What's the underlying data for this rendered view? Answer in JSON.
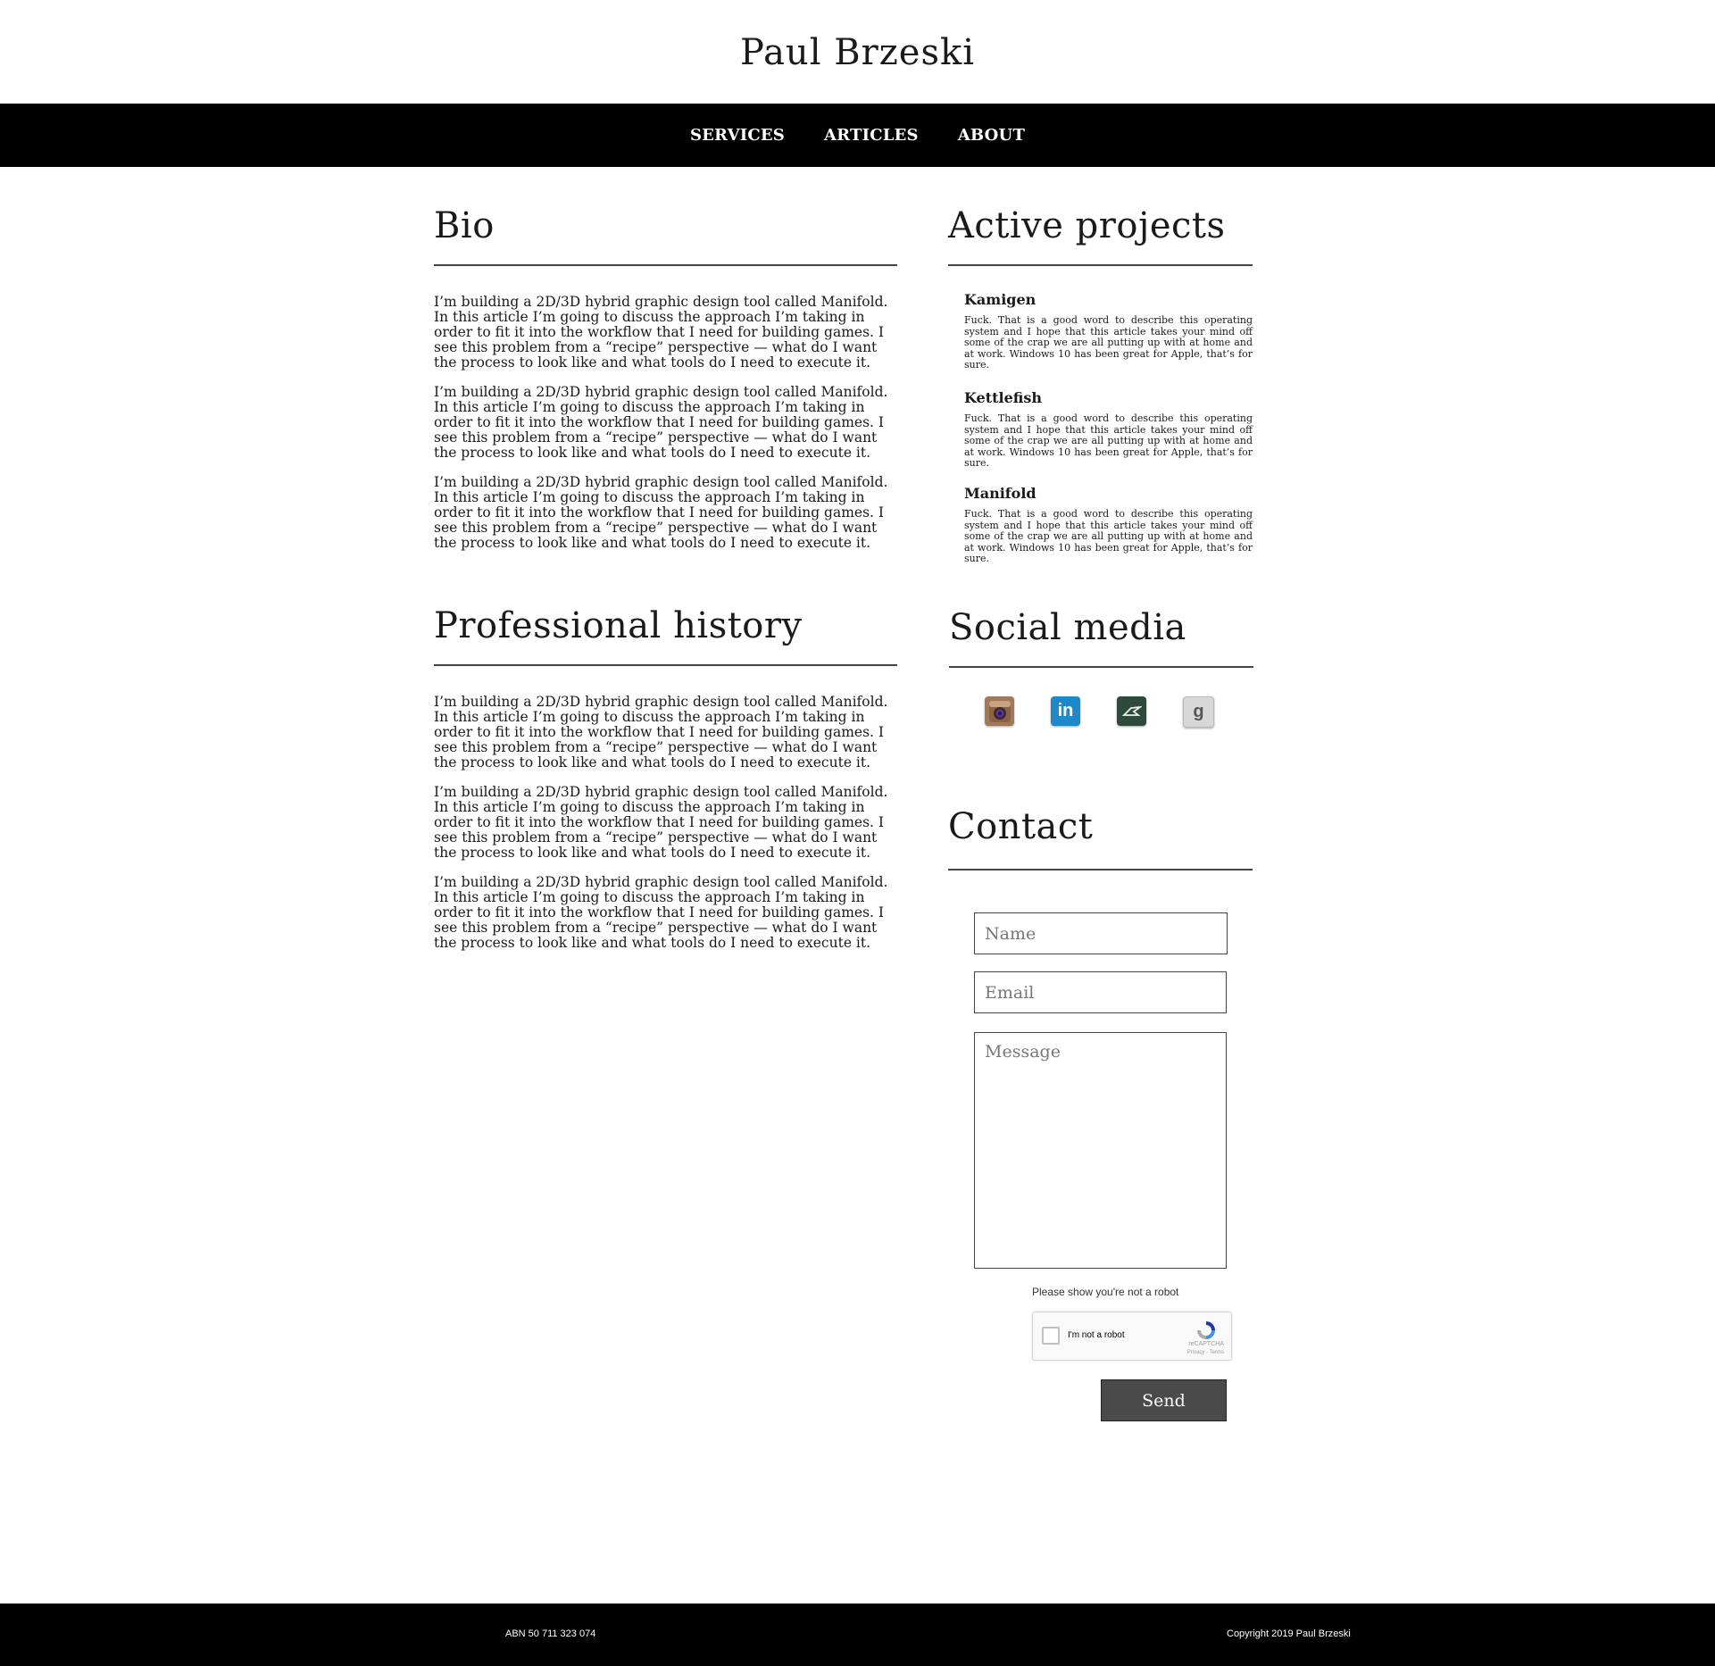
{
  "site": {
    "title": "Paul Brzeski"
  },
  "nav": {
    "items": [
      "SERVICES",
      "ARTICLES",
      "ABOUT"
    ]
  },
  "bio": {
    "heading": "Bio",
    "paragraphs": [
      "I’m building a 2D/3D hybrid graphic design tool called Manifold. In this article I’m going to discuss the approach I’m taking in order to fit it into the workflow that I need for building games. I see this problem from a “recipe” perspective — what do I want the process to look like and what tools do I need to execute it.",
      "I’m building a 2D/3D hybrid graphic design tool called Manifold. In this article I’m going to discuss the approach I’m taking in order to fit it into the workflow that I need for building games. I see this problem from a “recipe” perspective — what do I want the process to look like and what tools do I need to execute it.",
      "I’m building a 2D/3D hybrid graphic design tool called Manifold. In this article I’m going to discuss the approach I’m taking in order to fit it into the workflow that I need for building games. I see this problem from a “recipe” perspective — what do I want the process to look like and what tools do I need to execute it."
    ]
  },
  "projects": {
    "heading": "Active projects",
    "items": [
      {
        "name": "Kamigen",
        "description": "Fuck. That is a good word to describe this operating system and I hope that this article takes your mind off some of the crap we are all putting up with at home and at work. Windows 10 has been great for Apple, that’s for sure."
      },
      {
        "name": "Kettlefish",
        "description": "Fuck. That is a good word to describe this operating system and I hope that this article takes your mind off some of the crap we are all putting up with at home and at work. Windows 10 has been great for Apple, that’s for sure."
      },
      {
        "name": "Manifold",
        "description": "Fuck. That is a good word to describe this operating system and I hope that this article takes your mind off some of the crap we are all putting up with at home and at work. Windows 10 has been great for Apple, that’s for sure."
      }
    ]
  },
  "history": {
    "heading": "Professional history",
    "paragraphs": [
      "I’m building a 2D/3D hybrid graphic design tool called Manifold. In this article I’m going to discuss the approach I’m taking in order to fit it into the workflow that I need for building games. I see this problem from a “recipe” perspective — what do I want the process to look like and what tools do I need to execute it.",
      "I’m building a 2D/3D hybrid graphic design tool called Manifold. In this article I’m going to discuss the approach I’m taking in order to fit it into the workflow that I need for building games. I see this problem from a “recipe” perspective — what do I want the process to look like and what tools do I need to execute it.",
      "I’m building a 2D/3D hybrid graphic design tool called Manifold. In this article I’m going to discuss the approach I’m taking in order to fit it into the workflow that I need for building games. I see this problem from a “recipe” perspective — what do I want the process to look like and what tools do I need to execute it."
    ]
  },
  "social": {
    "heading": "Social media",
    "icons": [
      {
        "icon": "instagram-icon",
        "color": "#a0785a"
      },
      {
        "icon": "linkedin-icon",
        "color": "#1e88c9"
      },
      {
        "icon": "deviantart-icon",
        "color": "#2e4a3a"
      },
      {
        "icon": "goodreads-icon",
        "color": "#d8d8d8"
      }
    ]
  },
  "contact": {
    "heading": "Contact",
    "name_placeholder": "Name",
    "email_placeholder": "Email",
    "message_placeholder": "Message",
    "captcha_note": "Please show you're not a robot",
    "captcha_label": "I'm not a robot",
    "captcha_brand": "reCAPTCHA",
    "captcha_links": "Privacy - Terms",
    "send_label": "Send"
  },
  "footer": {
    "abn": "ABN 50 711 323 074",
    "copyright": "Copyright 2019 Paul Brzeski"
  }
}
